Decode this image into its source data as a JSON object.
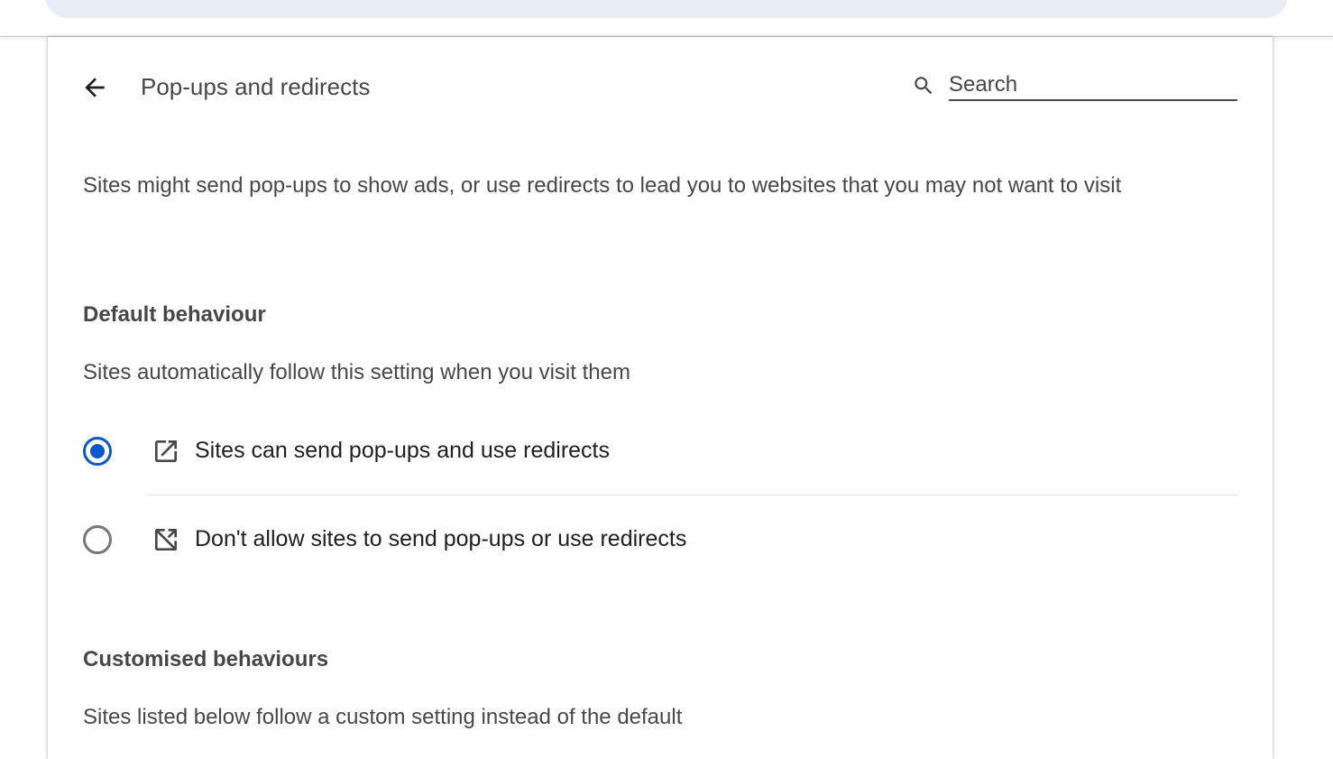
{
  "header": {
    "back_label": "Back",
    "title": "Pop-ups and redirects",
    "search_placeholder": "Search"
  },
  "description": "Sites might send pop-ups to show ads, or use redirects to lead you to websites that you may not want to visit",
  "default_behaviour": {
    "heading": "Default behaviour",
    "subtitle": "Sites automatically follow this setting when you visit them",
    "options": [
      {
        "label": "Sites can send pop-ups and use redirects",
        "icon": "open-in-new-icon",
        "checked": true
      },
      {
        "label": "Don't allow sites to send pop-ups or use redirects",
        "icon": "open-in-new-off-icon",
        "checked": false
      }
    ]
  },
  "customised_behaviours": {
    "heading": "Customised behaviours",
    "subtitle": "Sites listed below follow a custom setting instead of the default"
  },
  "colors": {
    "accent": "#0b57d0",
    "text_secondary": "#474747",
    "top_bar": "#e9edf6"
  }
}
